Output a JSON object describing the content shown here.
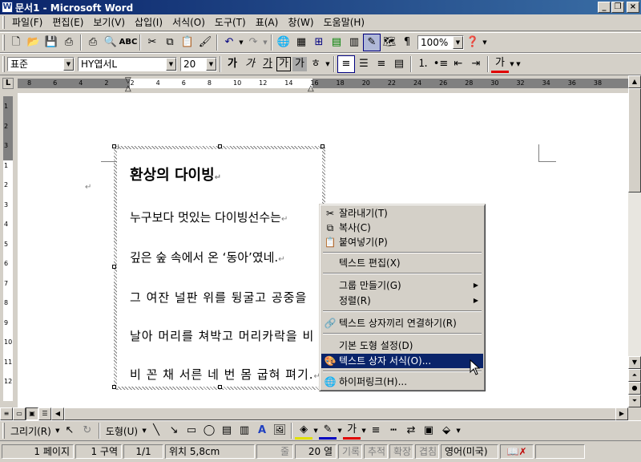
{
  "window": {
    "title": "문서1 - Microsoft Word",
    "icon": "W",
    "controls": [
      "minimize",
      "restore",
      "close"
    ]
  },
  "menubar": [
    "파일(F)",
    "편집(E)",
    "보기(V)",
    "삽입(I)",
    "서식(O)",
    "도구(T)",
    "표(A)",
    "창(W)",
    "도움말(H)"
  ],
  "standard_toolbar": {
    "zoom": "100%"
  },
  "formatting_toolbar": {
    "style": "표준",
    "font": "HY엽서L",
    "size": "20",
    "bold": "가",
    "italic": "가",
    "underline": "가",
    "char_border": "가",
    "char_shade": "가",
    "font_color": "가"
  },
  "ruler": {
    "numbers": [
      "8",
      "6",
      "4",
      "2",
      "2",
      "4",
      "6",
      "8",
      "10",
      "12",
      "14",
      "16",
      "18",
      "20",
      "22",
      "24",
      "26",
      "28",
      "30",
      "32",
      "34",
      "36",
      "38"
    ],
    "corner": "L"
  },
  "vruler": {
    "numbers": [
      "1",
      "2",
      "3",
      "1",
      "2",
      "3",
      "4",
      "5",
      "6",
      "7",
      "8",
      "9",
      "10",
      "11",
      "12"
    ]
  },
  "textbox": {
    "lines": [
      "환상의 다이빙",
      "누구보다 멋있는 다이빙선수는",
      "깊은 숲 속에서 온 ‘동아’였네.",
      "그 여잔 널판 위를 뒹굴고 공중을",
      "날아 머리를 쳐박고 머리카락을 비",
      "비 꼰 채 서른 네 번 몸 굽혀 펴기."
    ],
    "para_mark": "↵"
  },
  "context_menu": {
    "items": [
      {
        "label": "잘라내기(T)",
        "icon": "scissors-icon"
      },
      {
        "label": "복사(C)",
        "icon": "copy-icon"
      },
      {
        "label": "붙여넣기(P)",
        "icon": "paste-icon"
      },
      {
        "label": "텍스트 편집(X)",
        "icon": ""
      },
      {
        "label": "그룹 만들기(G)",
        "icon": "",
        "submenu": true
      },
      {
        "label": "정렬(R)",
        "icon": "",
        "submenu": true
      },
      {
        "label": "텍스트 상자끼리 연결하기(R)",
        "icon": "link-icon"
      },
      {
        "label": "기본 도형 설정(D)",
        "icon": ""
      },
      {
        "label": "텍스트 상자 서식(O)...",
        "icon": "format-textbox-icon"
      },
      {
        "label": "하이퍼링크(H)...",
        "icon": "globe-link-icon"
      }
    ]
  },
  "drawing_toolbar": {
    "draw": "그리기(R)",
    "autoshapes": "도형(U)"
  },
  "statusbar": {
    "page": "1 페이지",
    "section": "1 구역",
    "page_of": "1/1",
    "position": "위치 5,8cm",
    "line": "줄",
    "column": "20 열",
    "rec": "기록",
    "trk": "추적",
    "ext": "확장",
    "ovr": "겹침",
    "language": "영어(미국)"
  }
}
